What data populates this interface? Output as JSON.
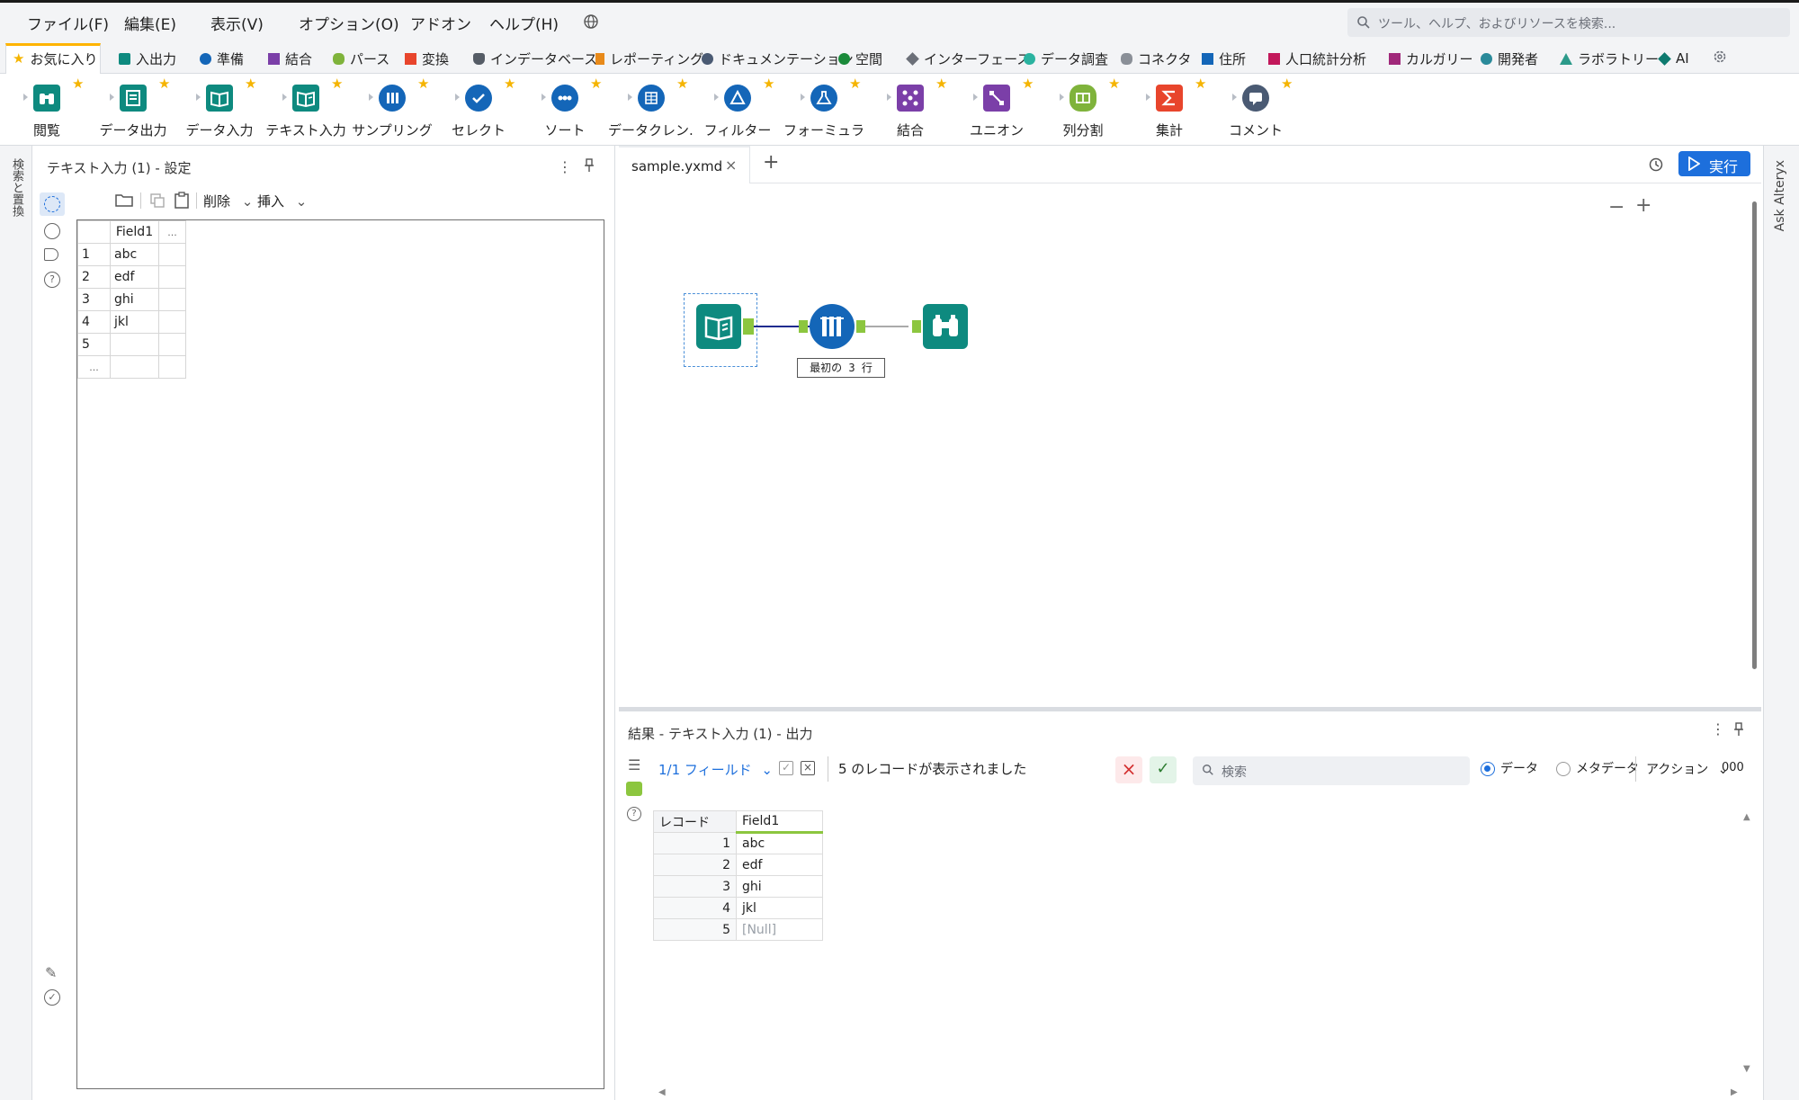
{
  "menu": {
    "items": [
      "ファイル(F)",
      "編集(E)",
      "表示(V)",
      "オプション(O)",
      "アドオン",
      "ヘルプ(H)"
    ],
    "search_placeholder": "ツール、ヘルプ、およびリソースを検索..."
  },
  "categories": [
    {
      "label": "お気に入り",
      "color": "#f5b400"
    },
    {
      "label": "入出力",
      "color": "#0e8a7f"
    },
    {
      "label": "準備",
      "color": "#1466b8"
    },
    {
      "label": "結合",
      "color": "#7b3fa8"
    },
    {
      "label": "パース",
      "color": "#7fb33b"
    },
    {
      "label": "変換",
      "color": "#e8452c"
    },
    {
      "label": "インデータベース",
      "color": "#555c66"
    },
    {
      "label": "レポーティング",
      "color": "#e88a1a"
    },
    {
      "label": "ドキュメンテーション",
      "color": "#4a5a73"
    },
    {
      "label": "空間",
      "color": "#1a8a3a"
    },
    {
      "label": "インターフェース",
      "color": "#6b6f78"
    },
    {
      "label": "データ調査",
      "color": "#2bb3a0"
    },
    {
      "label": "コネクタ",
      "color": "#8a8f97"
    },
    {
      "label": "住所",
      "color": "#1466b8"
    },
    {
      "label": "人口統計分析",
      "color": "#c2185b"
    },
    {
      "label": "カルガリー",
      "color": "#a0287a"
    },
    {
      "label": "開発者",
      "color": "#2a8a9a"
    },
    {
      "label": "ラボラトリー",
      "color": "#2c9a8a"
    },
    {
      "label": "AI",
      "color": "#0e7a6f"
    }
  ],
  "tools": [
    {
      "label": "閲覧",
      "icon": "browse-icon",
      "color": "#0e8a7f"
    },
    {
      "label": "データ出力",
      "icon": "output-data-icon",
      "color": "#0e8a7f"
    },
    {
      "label": "データ入力",
      "icon": "input-data-icon",
      "color": "#0e8a7f"
    },
    {
      "label": "テキスト入力",
      "icon": "text-input-icon",
      "color": "#0e8a7f"
    },
    {
      "label": "サンプリング",
      "icon": "sample-icon",
      "color": "#1466b8"
    },
    {
      "label": "セレクト",
      "icon": "select-icon",
      "color": "#1466b8"
    },
    {
      "label": "ソート",
      "icon": "sort-icon",
      "color": "#1466b8"
    },
    {
      "label": "データクレン...",
      "icon": "data-cleanse-icon",
      "color": "#1466b8"
    },
    {
      "label": "フィルター",
      "icon": "filter-icon",
      "color": "#1466b8"
    },
    {
      "label": "フォーミュラ",
      "icon": "formula-icon",
      "color": "#1466b8"
    },
    {
      "label": "結合",
      "icon": "join-icon",
      "color": "#7b3fa8"
    },
    {
      "label": "ユニオン",
      "icon": "union-icon",
      "color": "#7b3fa8"
    },
    {
      "label": "列分割",
      "icon": "text-to-columns-icon",
      "color": "#7fb33b"
    },
    {
      "label": "集計",
      "icon": "summarize-icon",
      "color": "#e8452c"
    },
    {
      "label": "コメント",
      "icon": "comment-icon",
      "color": "#4a5a73"
    }
  ],
  "left_strip": {
    "label": "検索と置換"
  },
  "config": {
    "title": "テキスト入力 (1) - 設定",
    "toolbar": {
      "delete": "削除",
      "insert": "挿入"
    },
    "grid": {
      "header": "Field1",
      "extra": "...",
      "rows": [
        {
          "n": "1",
          "v": "abc"
        },
        {
          "n": "2",
          "v": "edf"
        },
        {
          "n": "3",
          "v": "ghi"
        },
        {
          "n": "4",
          "v": "jkl"
        },
        {
          "n": "5",
          "v": ""
        }
      ],
      "more": "..."
    }
  },
  "canvas": {
    "tab_name": "sample.yxmd",
    "run_label": "実行",
    "sample_annotation": "最初の 3 行"
  },
  "right_strip": {
    "label": "Ask Alteryx"
  },
  "results": {
    "title": "結果 - テキスト入力 (1) - 出力",
    "fields": "1/1 フィールド",
    "message": "5 のレコードが表示されました",
    "search_placeholder": "検索",
    "radio_data": "データ",
    "radio_meta": "メタデータ",
    "actions": "アクション",
    "format": "000",
    "col_record": "レコード",
    "col_field": "Field1",
    "rows": [
      {
        "n": "1",
        "v": "abc"
      },
      {
        "n": "2",
        "v": "edf"
      },
      {
        "n": "3",
        "v": "ghi"
      },
      {
        "n": "4",
        "v": "jkl"
      },
      {
        "n": "5",
        "v": "[Null]"
      }
    ]
  }
}
